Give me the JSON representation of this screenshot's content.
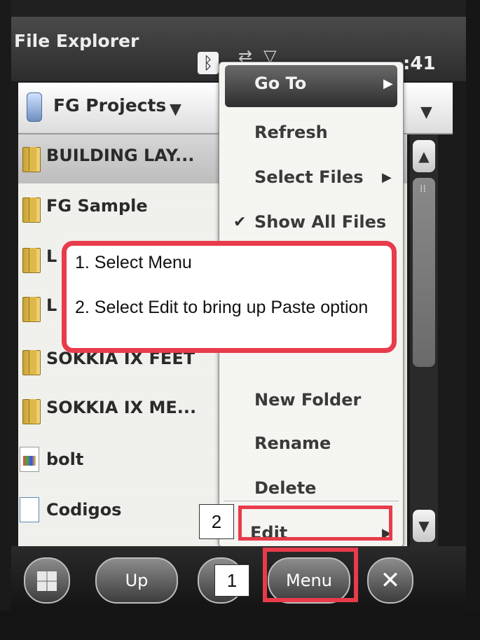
{
  "status_bar": {
    "app_title": "File Explorer",
    "clock": ":41",
    "bluetooth_icon": "bluetooth-icon"
  },
  "folder_bar": {
    "current_folder": "FG Projects"
  },
  "files": [
    {
      "name": "BUILDING LAY...",
      "type": "folder",
      "selected": true
    },
    {
      "name": "FG Sample",
      "type": "folder"
    },
    {
      "name": "L",
      "type": "folder"
    },
    {
      "name": "L",
      "type": "folder"
    },
    {
      "name": "SOKKIA IX FEET",
      "type": "folder"
    },
    {
      "name": "SOKKIA IX ME...",
      "type": "folder"
    },
    {
      "name": "bolt",
      "type": "image"
    },
    {
      "name": "Codigos",
      "type": "document"
    }
  ],
  "menu": {
    "items": [
      {
        "label": "Go To",
        "submenu": true,
        "highlighted": true
      },
      {
        "label": "Refresh"
      },
      {
        "label": "Select Files",
        "submenu": true
      },
      {
        "label": "Show All Files",
        "checked": true
      },
      {
        "label": "New Folder"
      },
      {
        "label": "Rename"
      },
      {
        "label": "Delete"
      },
      {
        "label": "Edit",
        "submenu": true
      }
    ]
  },
  "callout": {
    "text": "1. Select Menu\n\n2. Select Edit to bring up Paste option"
  },
  "steps": {
    "step1": "1",
    "step2": "2"
  },
  "softkeys": {
    "up": "Up",
    "menu": "Menu",
    "close": "✕"
  },
  "colors": {
    "annotation": "#e83b4b",
    "title_bar": "#3a3a3a"
  }
}
